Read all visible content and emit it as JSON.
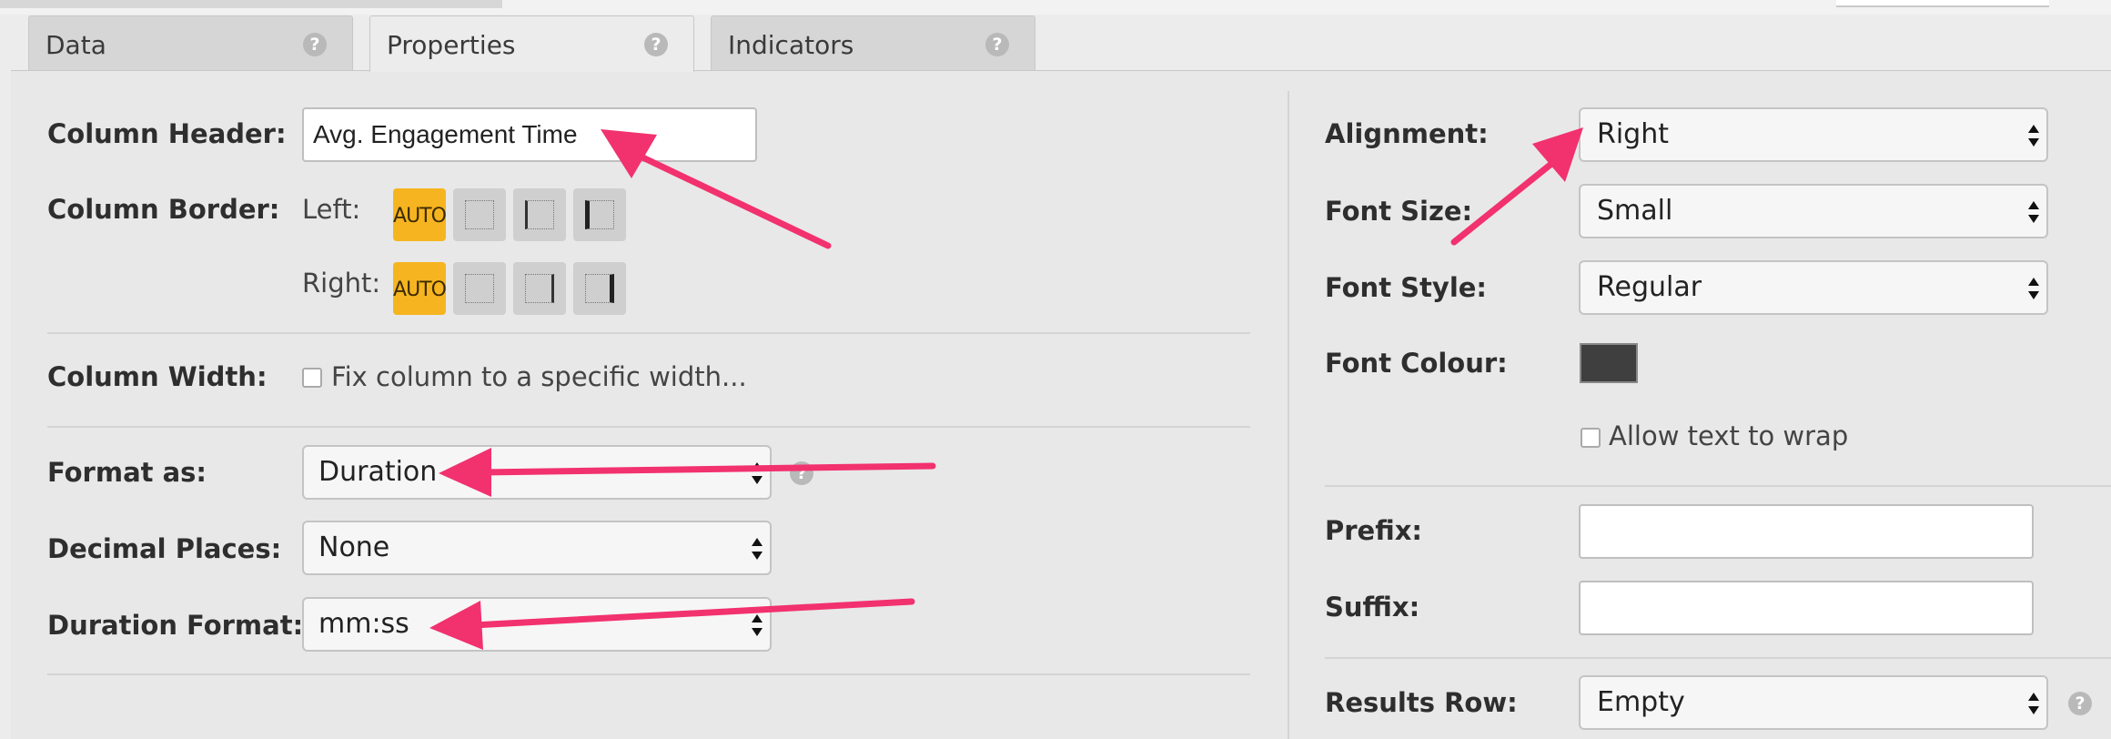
{
  "tabs": [
    {
      "label": "Data"
    },
    {
      "label": "Properties"
    },
    {
      "label": "Indicators"
    }
  ],
  "help_glyph": "?",
  "left": {
    "column_header": {
      "label": "Column Header:",
      "value": "Avg. Engagement Time"
    },
    "column_border": {
      "label": "Column Border:",
      "left_label": "Left:",
      "right_label": "Right:",
      "auto_label": "AUTO"
    },
    "column_width": {
      "label": "Column Width:",
      "checkbox_label": "Fix column to a specific width..."
    },
    "format_as": {
      "label": "Format as:",
      "value": "Duration"
    },
    "decimal_places": {
      "label": "Decimal Places:",
      "value": "None"
    },
    "duration_format": {
      "label": "Duration Format:",
      "value": "mm:ss"
    }
  },
  "right": {
    "alignment": {
      "label": "Alignment:",
      "value": "Right"
    },
    "font_size": {
      "label": "Font Size:",
      "value": "Small"
    },
    "font_style": {
      "label": "Font Style:",
      "value": "Regular"
    },
    "font_colour": {
      "label": "Font Colour:",
      "color": "#3f3f3f"
    },
    "wrap": {
      "checkbox_label": "Allow text to wrap"
    },
    "prefix": {
      "label": "Prefix:",
      "value": ""
    },
    "suffix": {
      "label": "Suffix:",
      "value": ""
    },
    "results_row": {
      "label": "Results Row:",
      "value": "Empty"
    }
  },
  "colors": {
    "annotation_arrow": "#f2316f",
    "auto_button": "#f6b520"
  }
}
